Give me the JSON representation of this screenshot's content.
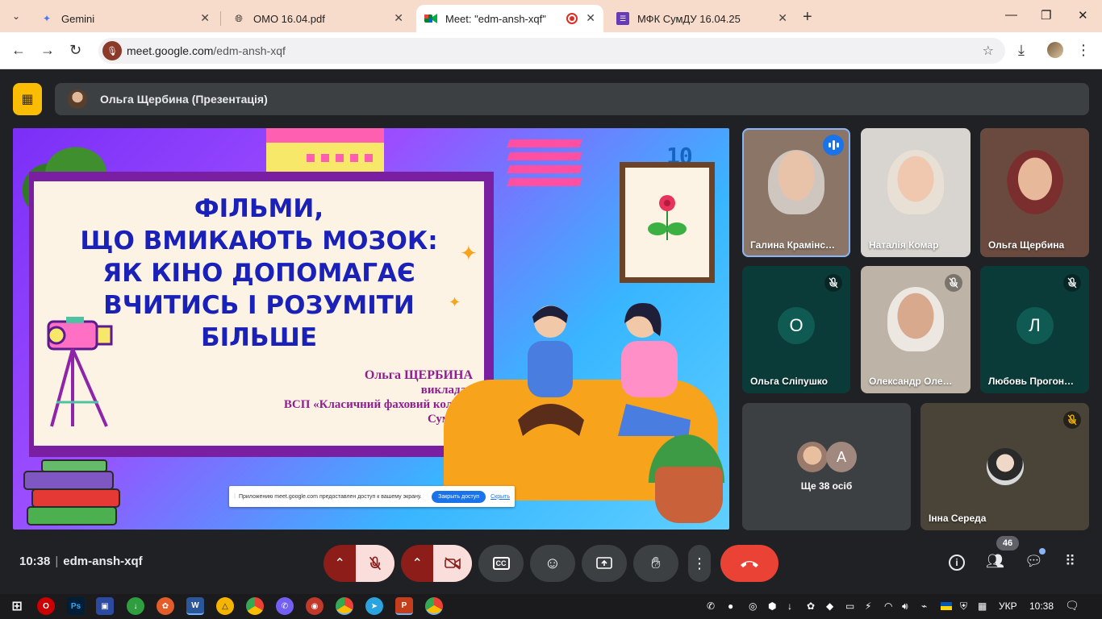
{
  "browser": {
    "tabs": [
      {
        "title": "Gemini",
        "active": false
      },
      {
        "title": "ОМО 16.04.pdf",
        "active": false
      },
      {
        "title": "Meet: \"edm-ansh-xqf\"",
        "active": true
      },
      {
        "title": "МФК СумДУ 16.04.25",
        "active": false
      }
    ],
    "url_host": "meet.google.com",
    "url_path": "/edm-ansh-xqf"
  },
  "meet": {
    "presenter_name": "Ольга Щербина (Презентація)",
    "slide": {
      "clock": "10 38",
      "title_lines": [
        "ФІЛЬМИ,",
        "ЩО ВМИКАЮТЬ МОЗОК:",
        "ЯК КІНО ДОПОМАГАЄ",
        "ВЧИТИСЬ І РОЗУМІТИ",
        "БІЛЬШЕ"
      ],
      "author_name": "Ольга ЩЕРБИНА",
      "author_role": "викладач",
      "author_org_1": "ВСП «Класичний фаховий коледж",
      "author_org_2": "СумДУ»"
    },
    "share_notice": {
      "text": "Приложению meet.google.com предоставлен доступ к вашему экрану.",
      "stop_label": "Закрыть доступ",
      "hide_label": "Скрыть"
    },
    "participants": [
      {
        "name": "Галина Крамінс…"
      },
      {
        "name": "Наталія Комар"
      },
      {
        "name": "Ольга Щербина"
      },
      {
        "name": "Ольга Сліпушко",
        "initial": "О"
      },
      {
        "name": "Олександр Оле…"
      },
      {
        "name": "Любовь Прогон…",
        "initial": "Л"
      },
      {
        "name": "Інна Середа"
      }
    ],
    "more": {
      "label": "Ще 38 осіб",
      "initial": "А"
    },
    "bottom": {
      "time": "10:38",
      "meeting_code": "edm-ansh-xqf",
      "participant_count": "46"
    }
  },
  "taskbar": {
    "language": "УКР",
    "time": "10:38"
  },
  "colors": {
    "tab_strip": "#f8dccb",
    "meet_bg": "#202124",
    "hangup": "#ea4335",
    "accent_yellow": "#fbbc04",
    "slide_title": "#1a21b8",
    "slide_author": "#8e1f8e"
  }
}
